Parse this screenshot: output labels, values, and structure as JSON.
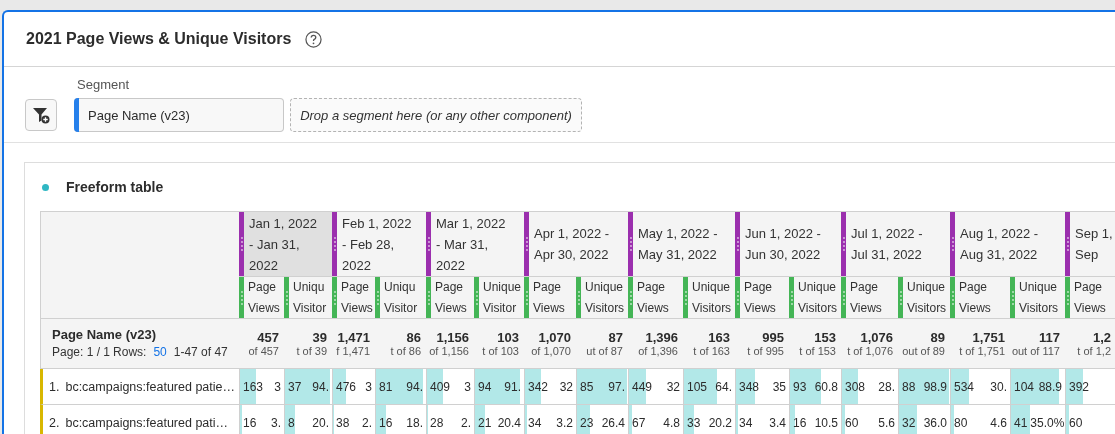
{
  "panel": {
    "title": "2021 Page Views & Unique Visitors"
  },
  "segment": {
    "label": "Segment",
    "chip": "Page Name (v23)",
    "drop_placeholder": "Drop a segment here (or any other component)"
  },
  "table": {
    "title": "Freeform table",
    "dimension": "Page Name (v23)",
    "pagination": {
      "page": "Page: 1 / 1",
      "rows_label": "Rows:",
      "rows": "50",
      "range": "1-47 of 47"
    },
    "date_columns": [
      {
        "lines": [
          "Jan 1, 2022",
          "- Jan 31,",
          "2022"
        ],
        "selected": true,
        "metrics": [
          {
            "label": "Page Views",
            "total": "457",
            "total_sub": "of 457"
          },
          {
            "label": "Uniqu Visitor",
            "total": "39",
            "total_sub": "t of 39"
          }
        ]
      },
      {
        "lines": [
          "Feb 1, 2022",
          "- Feb 28,",
          "2022"
        ],
        "selected": false,
        "metrics": [
          {
            "label": "Page Views",
            "total": "1,471",
            "total_sub": "f 1,471"
          },
          {
            "label": "Uniqu Visitor",
            "total": "86",
            "total_sub": "t of 86"
          }
        ]
      },
      {
        "lines": [
          "Mar 1, 2022",
          "- Mar 31,",
          "2022"
        ],
        "selected": false,
        "metrics": [
          {
            "label": "Page Views",
            "total": "1,156",
            "total_sub": "of 1,156"
          },
          {
            "label": "Unique Visitor",
            "total": "103",
            "total_sub": "t of 103"
          }
        ]
      },
      {
        "lines": [
          "Apr 1, 2022 -",
          "Apr 30, 2022"
        ],
        "selected": false,
        "metrics": [
          {
            "label": "Page Views",
            "total": "1,070",
            "total_sub": "of 1,070"
          },
          {
            "label": "Unique Visitors",
            "total": "87",
            "total_sub": "ut of 87"
          }
        ]
      },
      {
        "lines": [
          "May 1, 2022 -",
          "May 31, 2022"
        ],
        "selected": false,
        "metrics": [
          {
            "label": "Page Views",
            "total": "1,396",
            "total_sub": "of 1,396"
          },
          {
            "label": "Unique Visitors",
            "total": "163",
            "total_sub": "t of 163"
          }
        ]
      },
      {
        "lines": [
          "Jun 1, 2022 -",
          "Jun 30, 2022"
        ],
        "selected": false,
        "metrics": [
          {
            "label": "Page Views",
            "total": "995",
            "total_sub": "t of 995"
          },
          {
            "label": "Unique Visitors",
            "total": "153",
            "total_sub": "t of 153"
          }
        ]
      },
      {
        "lines": [
          "Jul 1, 2022 -",
          "Jul 31, 2022"
        ],
        "selected": false,
        "metrics": [
          {
            "label": "Page Views",
            "total": "1,076",
            "total_sub": "t of 1,076"
          },
          {
            "label": "Unique Visitors",
            "total": "89",
            "total_sub": "out of 89"
          }
        ]
      },
      {
        "lines": [
          "Aug 1, 2022 -",
          "Aug 31, 2022"
        ],
        "selected": false,
        "metrics": [
          {
            "label": "Page Views",
            "total": "1,751",
            "total_sub": "t of 1,751"
          },
          {
            "label": "Unique Visitors",
            "total": "117",
            "total_sub": "out of 117"
          }
        ]
      },
      {
        "lines": [
          "Sep 1,",
          "Sep"
        ],
        "selected": false,
        "metrics": [
          {
            "label": "Page Views",
            "total": "1,2",
            "total_sub": "t of 1,2"
          }
        ]
      }
    ],
    "rows": [
      {
        "index": "1.",
        "name": "bc:campaigns:featured patie…",
        "cells": [
          {
            "value": "163",
            "percent": "3",
            "level": 0.36
          },
          {
            "value": "37",
            "percent": "94.",
            "level": 0.95
          },
          {
            "value": "476",
            "percent": "3",
            "level": 0.32
          },
          {
            "value": "81",
            "percent": "94.",
            "level": 0.94
          },
          {
            "value": "409",
            "percent": "3",
            "level": 0.35
          },
          {
            "value": "94",
            "percent": "91.",
            "level": 0.91
          },
          {
            "value": "342",
            "percent": "32",
            "level": 0.32
          },
          {
            "value": "85",
            "percent": "97.",
            "level": 0.98
          },
          {
            "value": "449",
            "percent": "32",
            "level": 0.32
          },
          {
            "value": "105",
            "percent": "64.",
            "level": 0.64
          },
          {
            "value": "348",
            "percent": "35",
            "level": 0.35
          },
          {
            "value": "93",
            "percent": "60.8",
            "level": 0.61
          },
          {
            "value": "308",
            "percent": "28.",
            "level": 0.29
          },
          {
            "value": "88",
            "percent": "98.9",
            "level": 0.99
          },
          {
            "value": "534",
            "percent": "30.",
            "level": 0.3
          },
          {
            "value": "104",
            "percent": "88.9",
            "level": 0.89
          },
          {
            "value": "392",
            "level": 0.33
          }
        ]
      },
      {
        "index": "2.",
        "name": "bc:campaigns:featured pati…",
        "cells": [
          {
            "value": "16",
            "percent": "3.",
            "level": 0.035
          },
          {
            "value": "8",
            "percent": "20.",
            "level": 0.21
          },
          {
            "value": "38",
            "percent": "2.",
            "level": 0.026
          },
          {
            "value": "16",
            "percent": "18.",
            "level": 0.19
          },
          {
            "value": "28",
            "percent": "2.",
            "level": 0.024
          },
          {
            "value": "21",
            "percent": "20.4",
            "level": 0.2
          },
          {
            "value": "34",
            "percent": "3.2",
            "level": 0.032
          },
          {
            "value": "23",
            "percent": "26.4",
            "level": 0.26
          },
          {
            "value": "67",
            "percent": "4.8",
            "level": 0.048
          },
          {
            "value": "33",
            "percent": "20.2",
            "level": 0.2
          },
          {
            "value": "34",
            "percent": "3.4",
            "level": 0.034
          },
          {
            "value": "16",
            "percent": "10.5",
            "level": 0.1
          },
          {
            "value": "60",
            "percent": "5.6",
            "level": 0.056
          },
          {
            "value": "32",
            "percent": "36.0",
            "level": 0.36
          },
          {
            "value": "80",
            "percent": "4.6",
            "level": 0.046
          },
          {
            "value": "41",
            "percent": "35.0%",
            "level": 0.35
          },
          {
            "value": "60",
            "level": 0.05
          }
        ]
      }
    ]
  }
}
